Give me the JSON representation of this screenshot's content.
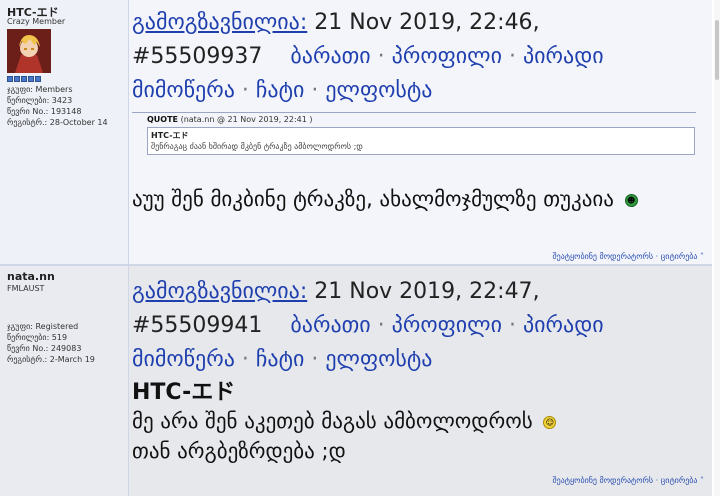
{
  "post1": {
    "username": "HTC-エド",
    "user_title": "Crazy Member",
    "group": "ჯგუფი: Members",
    "posts": "წერილები: 3423",
    "member_no": "წევრი No.: 193148",
    "registered": "რეგისტრ.: 28-October 14",
    "posted_label": "გამოგზავნილია:",
    "date": "21 Nov 2019, 22:46",
    "post_id": "#55509937",
    "links": [
      "ბარათი",
      "პროფილი",
      "პირადი მიმოწერა",
      "ჩატი",
      "ელფოსტა"
    ],
    "quote": {
      "label": "QUOTE",
      "meta": "(nata.nn @ 21 Nov 2019, 22:41 )",
      "author": "HTC-エド",
      "text": "შენრაგაც ძაან ხშირად მკბენ ტრაკზე ამბოლოდროს ;დ"
    },
    "body": "აუუ შენ მიკბინე ტრაკზე, ახალმოჯმულზე თუკაია",
    "footer": [
      "შეატყობინე მოდერატორს",
      "ციტირება"
    ]
  },
  "post2": {
    "username": "nata.nn",
    "user_title": "FMLAUST",
    "group": "ჯგუფი: Registered",
    "posts": "წერილები: 519",
    "member_no": "წევრი No.: 249083",
    "registered": "რეგისტრ.: 2-March 19",
    "posted_label": "გამოგზავნილია:",
    "date": "21 Nov 2019, 22:47",
    "post_id": "#55509941",
    "links": [
      "ბარათი",
      "პროფილი",
      "პირადი მიმოწერა",
      "ჩატი",
      "ელფოსტა"
    ],
    "body_title": "HTC-エド",
    "body": "მე არა შენ აკეთებ მაგას ამბოლოდროს",
    "body2": "თან არგბეზრდება ;დ",
    "footer": [
      "შეატყობინე მოდერატორს",
      "ციტირება"
    ]
  },
  "colors": {
    "link": "#1f3fae",
    "post1_bg": "#f3f5fa",
    "post2_bg": "#e6e8ec"
  }
}
